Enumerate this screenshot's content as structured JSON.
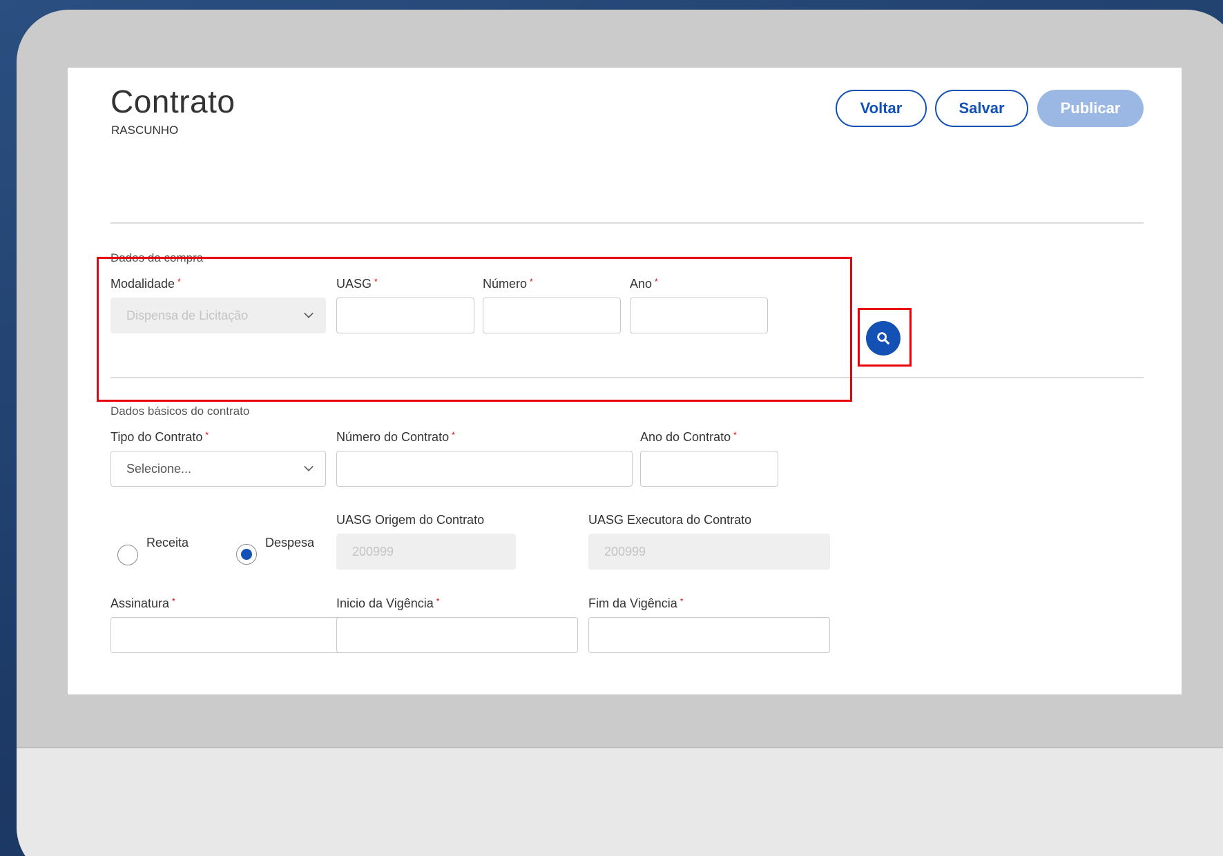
{
  "page": {
    "title": "Contrato",
    "status": "RASCUNHO"
  },
  "buttons": {
    "back": "Voltar",
    "save": "Salvar",
    "publish": "Publicar"
  },
  "purchase_section": {
    "title": "Dados da compra",
    "modalidade": {
      "label": "Modalidade",
      "value": "Dispensa de Licitação"
    },
    "uasg": {
      "label": "UASG",
      "value": ""
    },
    "numero": {
      "label": "Número",
      "value": ""
    },
    "ano": {
      "label": "Ano",
      "value": ""
    },
    "search_icon": "search-icon"
  },
  "basic_section": {
    "title": "Dados básicos do contrato",
    "tipo": {
      "label": "Tipo do Contrato",
      "placeholder": "Selecione..."
    },
    "numero_contrato": {
      "label": "Número do Contrato",
      "value": ""
    },
    "ano_contrato": {
      "label": "Ano do Contrato",
      "value": ""
    },
    "radio_receita": "Receita",
    "radio_despesa": "Despesa",
    "selected_radio": "Despesa",
    "uasg_origem": {
      "label": "UASG Origem do Contrato",
      "value": "200999"
    },
    "uasg_executora": {
      "label": "UASG Executora do Contrato",
      "value": "200999"
    },
    "assinatura": {
      "label": "Assinatura"
    },
    "inicio_vigencia": {
      "label": "Inicio da Vigência"
    },
    "fim_vigencia": {
      "label": "Fim da Vigência"
    }
  },
  "colors": {
    "primary": "#1351b4",
    "primary_disabled": "#9bb8e5",
    "highlight": "#e8000b",
    "required": "#e60000"
  }
}
